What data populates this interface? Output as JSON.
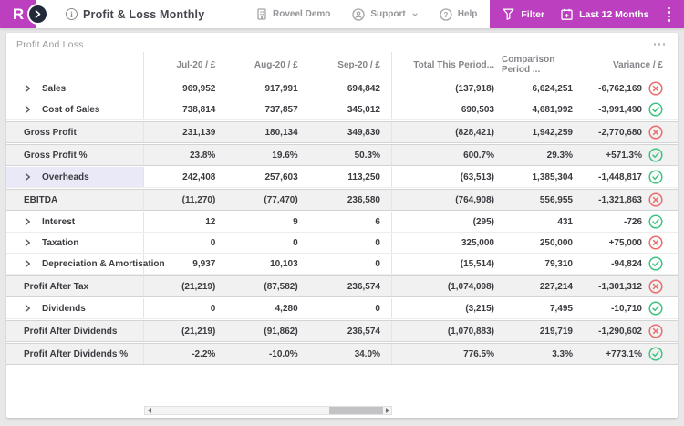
{
  "header": {
    "logo_letter": "R",
    "title": "Profit & Loss Monthly",
    "nav": {
      "company": "Roveel Demo",
      "support": "Support",
      "help": "Help"
    },
    "actions": {
      "filter": "Filter",
      "period": "Last 12 Months"
    },
    "brand_color": "#BB3FBF"
  },
  "card": {
    "title": "Profit And Loss",
    "columns": [
      "Jul-20 / £",
      "Aug-20 / £",
      "Sep-20 / £",
      "Total This Period...",
      "Comparison Period ...",
      "Variance / £"
    ],
    "rows": [
      {
        "type": "detail",
        "label": "Sales",
        "expandable": true,
        "values": [
          "969,952",
          "917,991",
          "694,842",
          "(137,918)",
          "6,624,251",
          "-6,762,169"
        ],
        "status": "bad"
      },
      {
        "type": "detail",
        "label": "Cost of Sales",
        "expandable": true,
        "values": [
          "738,814",
          "737,857",
          "345,012",
          "690,503",
          "4,681,992",
          "-3,991,490"
        ],
        "status": "good"
      },
      {
        "type": "summary",
        "label": "Gross Profit",
        "expandable": false,
        "values": [
          "231,139",
          "180,134",
          "349,830",
          "(828,421)",
          "1,942,259",
          "-2,770,680"
        ],
        "status": "bad"
      },
      {
        "type": "summary",
        "label": "Gross Profit %",
        "expandable": false,
        "values": [
          "23.8%",
          "19.6%",
          "50.3%",
          "600.7%",
          "29.3%",
          "+571.3%"
        ],
        "status": "good"
      },
      {
        "type": "detail",
        "label": "Overheads",
        "expandable": true,
        "highlighted": true,
        "values": [
          "242,408",
          "257,603",
          "113,250",
          "(63,513)",
          "1,385,304",
          "-1,448,817"
        ],
        "status": "good"
      },
      {
        "type": "summary",
        "label": "EBITDA",
        "expandable": false,
        "values": [
          "(11,270)",
          "(77,470)",
          "236,580",
          "(764,908)",
          "556,955",
          "-1,321,863"
        ],
        "status": "bad"
      },
      {
        "type": "detail",
        "label": "Interest",
        "expandable": true,
        "values": [
          "12",
          "9",
          "6",
          "(295)",
          "431",
          "-726"
        ],
        "status": "good"
      },
      {
        "type": "detail",
        "label": "Taxation",
        "expandable": true,
        "values": [
          "0",
          "0",
          "0",
          "325,000",
          "250,000",
          "+75,000"
        ],
        "status": "bad"
      },
      {
        "type": "detail",
        "label": "Depreciation & Amortisation",
        "expandable": true,
        "values": [
          "9,937",
          "10,103",
          "0",
          "(15,514)",
          "79,310",
          "-94,824"
        ],
        "status": "good"
      },
      {
        "type": "summary",
        "label": "Profit After Tax",
        "expandable": false,
        "values": [
          "(21,219)",
          "(87,582)",
          "236,574",
          "(1,074,098)",
          "227,214",
          "-1,301,312"
        ],
        "status": "bad"
      },
      {
        "type": "detail",
        "label": "Dividends",
        "expandable": true,
        "values": [
          "0",
          "4,280",
          "0",
          "(3,215)",
          "7,495",
          "-10,710"
        ],
        "status": "good"
      },
      {
        "type": "summary",
        "label": "Profit After Dividends",
        "expandable": false,
        "values": [
          "(21,219)",
          "(91,862)",
          "236,574",
          "(1,070,883)",
          "219,719",
          "-1,290,602"
        ],
        "status": "bad"
      },
      {
        "type": "summary",
        "label": "Profit After Dividends %",
        "expandable": false,
        "values": [
          "-2.2%",
          "-10.0%",
          "34.0%",
          "776.5%",
          "3.3%",
          "+773.1%"
        ],
        "status": "good"
      }
    ]
  },
  "colors": {
    "good": "#41C380",
    "bad": "#EA6C6C"
  }
}
